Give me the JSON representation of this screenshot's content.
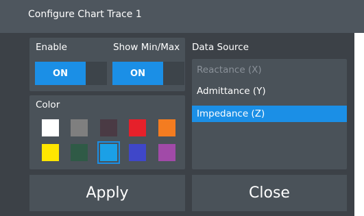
{
  "dialog": {
    "title": "Configure Chart Trace 1",
    "enable": {
      "label": "Enable",
      "state": "ON"
    },
    "show_minmax": {
      "label": "Show Min/Max",
      "state": "ON"
    },
    "color": {
      "label": "Color",
      "swatches": [
        {
          "name": "white",
          "hex": "#ffffff"
        },
        {
          "name": "gray",
          "hex": "#7f7f7f"
        },
        {
          "name": "dark-maroon",
          "hex": "#4a3a44"
        },
        {
          "name": "red",
          "hex": "#e6202a"
        },
        {
          "name": "orange",
          "hex": "#f47c20"
        },
        {
          "name": "yellow",
          "hex": "#ffe600"
        },
        {
          "name": "dark-green",
          "hex": "#2f5a46"
        },
        {
          "name": "light-blue",
          "hex": "#1ba0e6"
        },
        {
          "name": "blue",
          "hex": "#3f47c9"
        },
        {
          "name": "purple",
          "hex": "#a14aa8"
        }
      ],
      "selected": "light-blue"
    },
    "data_source": {
      "label": "Data Source",
      "items": [
        {
          "label": "Reactance (X)",
          "state": "disabled"
        },
        {
          "label": "Admittance (Y)",
          "state": "normal"
        },
        {
          "label": "Impedance (Z)",
          "state": "selected"
        }
      ]
    },
    "buttons": {
      "apply": "Apply",
      "close": "Close"
    }
  }
}
